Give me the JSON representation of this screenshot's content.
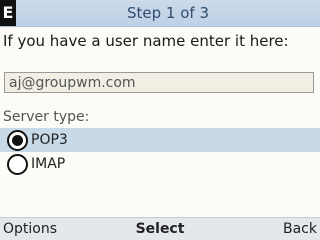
{
  "header": {
    "badge": "E",
    "title": "Step 1 of 3"
  },
  "form": {
    "prompt": "If you have a user name enter it here:",
    "username_value": "aj@groupwm.com",
    "server_type_label": "Server type:",
    "options": [
      {
        "label": "POP3",
        "selected": true
      },
      {
        "label": "IMAP",
        "selected": false
      }
    ]
  },
  "softkeys": {
    "left": "Options",
    "center": "Select",
    "right": "Back"
  }
}
